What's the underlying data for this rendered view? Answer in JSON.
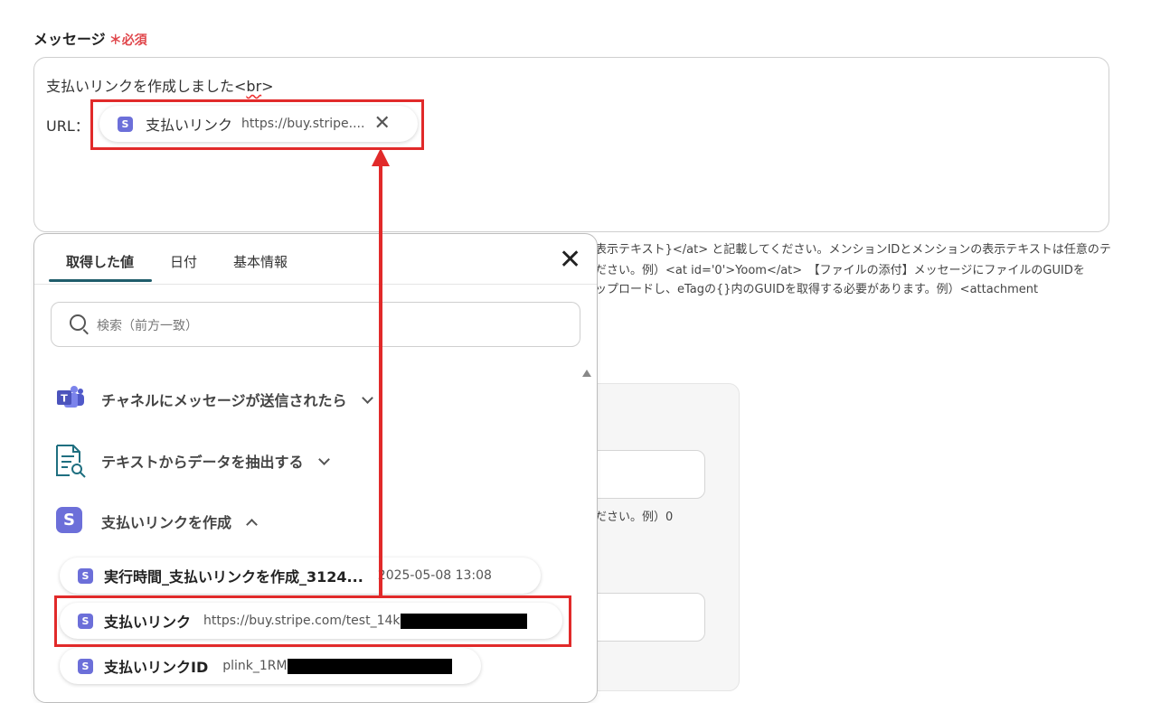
{
  "field": {
    "label": "メッセージ",
    "required_mark": "＊",
    "required_text": "必須"
  },
  "message": {
    "line1_prefix": "支払いリンクを作成しました<",
    "line1_tag": "br",
    "line1_suffix": ">",
    "url_label": "URL：",
    "chip": {
      "icon": "S",
      "name": "支払いリンク",
      "value": "https://buy.stripe....",
      "remove_icon": "✕"
    }
  },
  "help_text": [
    "表示テキスト}</at> と記載してください。メンションIDとメンションの表示テキストは任意のテ",
    "ださい。例）<at id='0'>Yoom</at>　【ファイルの添付】メッセージにファイルのGUIDを",
    "ップロードし、eTagの{}内のGUIDを取得する必要があります。例）<attachment"
  ],
  "bg_example": "ださい。例）0",
  "popup": {
    "tabs": [
      {
        "label": "取得した値",
        "active": true
      },
      {
        "label": "日付",
        "active": false
      },
      {
        "label": "基本情報",
        "active": false
      }
    ],
    "close_icon": "✕",
    "search_placeholder": "検索（前方一致）",
    "groups": [
      {
        "label": "チャネルにメッセージが送信されたら",
        "icon": "teams-icon",
        "expanded": false
      },
      {
        "label": "テキストからデータを抽出する",
        "icon": "document-search-icon",
        "expanded": false
      },
      {
        "label": "支払いリンクを作成",
        "icon": "stripe-icon",
        "icon_text": "S",
        "expanded": true
      }
    ],
    "items": [
      {
        "icon": "S",
        "name": "実行時間_支払いリンクを作成_3124...",
        "value": "2025-05-08 13:08"
      },
      {
        "icon": "S",
        "name": "支払いリンク",
        "value": "https://buy.stripe.com/test_14k"
      },
      {
        "icon": "S",
        "name": "支払いリンクID",
        "value": "plink_1RM"
      }
    ]
  },
  "colors": {
    "accent": "#e12a2a",
    "stripe": "#6c6fd9",
    "tab_underline": "#1f5d6b"
  }
}
